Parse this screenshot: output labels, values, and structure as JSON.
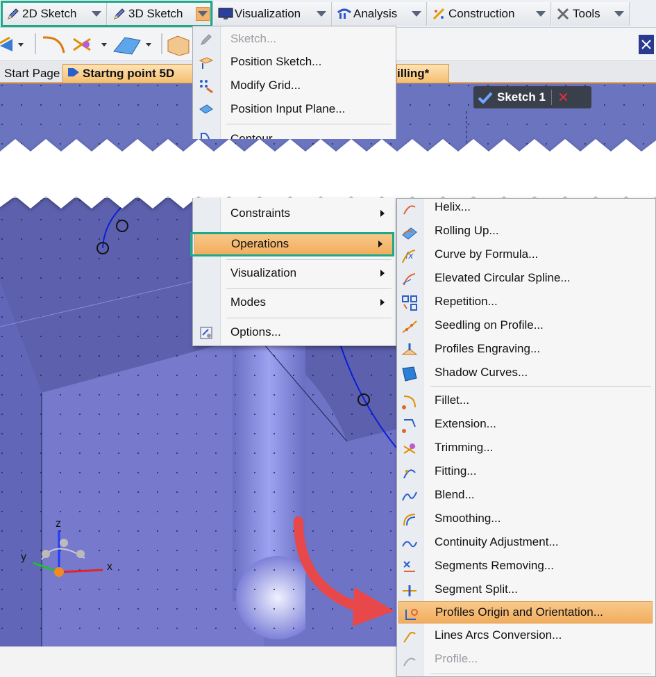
{
  "ribbon": {
    "tabs": [
      {
        "label": "2D Sketch",
        "icon": "pencil-icon"
      },
      {
        "label": "3D Sketch",
        "icon": "pencil-icon"
      },
      {
        "label": "Visualization",
        "icon": "monitor-icon"
      },
      {
        "label": "Analysis",
        "icon": "analysis-icon"
      },
      {
        "label": "Construction",
        "icon": "construction-icon"
      },
      {
        "label": "Tools",
        "icon": "tools-icon"
      }
    ]
  },
  "doc_tabs": {
    "start_page": "Start Page",
    "active": "Startng point 5D",
    "other": "illing*"
  },
  "sketch_pill": {
    "label": "Sketch 1"
  },
  "axes": {
    "x": "x",
    "y": "y",
    "z": "z"
  },
  "menu1": {
    "items": [
      {
        "label": "Sketch...",
        "disabled": true
      },
      {
        "label": "Position Sketch..."
      },
      {
        "label": "Modify Grid..."
      },
      {
        "label": "Position Input Plane..."
      },
      {
        "label": "Contour..."
      },
      {
        "label": "Constraints"
      },
      {
        "label": "Operations"
      },
      {
        "label": "Visualization"
      },
      {
        "label": "Modes"
      },
      {
        "label": "Options..."
      }
    ]
  },
  "menu2": {
    "items": [
      {
        "label": "Helix..."
      },
      {
        "label": "Rolling Up..."
      },
      {
        "label": "Curve by Formula..."
      },
      {
        "label": "Elevated Circular Spline..."
      },
      {
        "label": "Repetition..."
      },
      {
        "label": "Seedling on Profile..."
      },
      {
        "label": "Profiles Engraving..."
      },
      {
        "label": "Shadow Curves..."
      },
      {
        "label": "Fillet..."
      },
      {
        "label": "Extension..."
      },
      {
        "label": "Trimming..."
      },
      {
        "label": "Fitting..."
      },
      {
        "label": "Blend..."
      },
      {
        "label": "Smoothing..."
      },
      {
        "label": "Continuity Adjustment..."
      },
      {
        "label": "Segments Removing..."
      },
      {
        "label": "Segment Split..."
      },
      {
        "label": "Profiles Origin and Orientation..."
      },
      {
        "label": "Lines Arcs Conversion..."
      },
      {
        "label": "Profile..."
      }
    ]
  },
  "colors": {
    "highlight_border": "#1ea98b",
    "menu_highlight": "#f2ad5e",
    "viewport": "#6e73c6",
    "arrow": "#e8484a"
  }
}
